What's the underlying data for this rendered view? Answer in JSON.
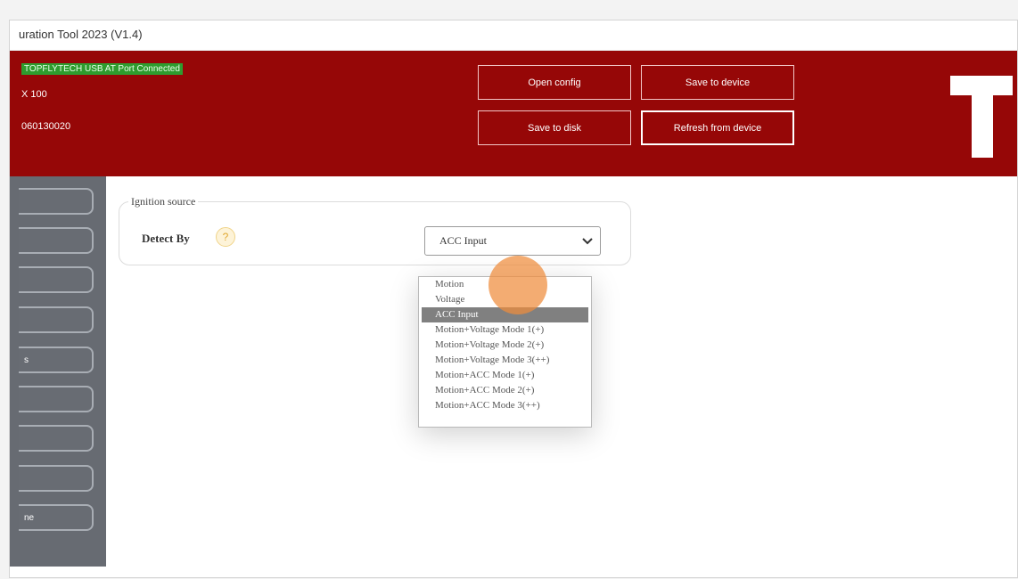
{
  "window": {
    "title": "uration Tool 2023 (V1.4)"
  },
  "header": {
    "connection_status": "TOPFLYTECH USB AT Port Connected",
    "model": "X 100",
    "serial": "060130020",
    "buttons": {
      "open_config": "Open config",
      "save_to_device": "Save to device",
      "save_to_disk": "Save to disk",
      "refresh_from_device": "Refresh from device"
    },
    "brand_color": "#960707"
  },
  "sidebar": {
    "items": [
      {
        "label": ""
      },
      {
        "label": ""
      },
      {
        "label": ""
      },
      {
        "label": ""
      },
      {
        "label": "s"
      },
      {
        "label": ""
      },
      {
        "label": ""
      },
      {
        "label": ""
      },
      {
        "label": "ne"
      }
    ]
  },
  "main": {
    "group_title": "Ignition source",
    "detect_label": "Detect By",
    "help_icon": "?",
    "select_value": "ACC Input",
    "dropdown_options": [
      "Motion",
      "Voltage",
      "ACC Input",
      "Motion+Voltage Mode 1(+)",
      "Motion+Voltage Mode 2(+)",
      "Motion+Voltage Mode 3(++)",
      "Motion+ACC Mode 1(+)",
      "Motion+ACC Mode 2(+)",
      "Motion+ACC Mode 3(++)"
    ],
    "highlighted_option": "ACC Input"
  }
}
